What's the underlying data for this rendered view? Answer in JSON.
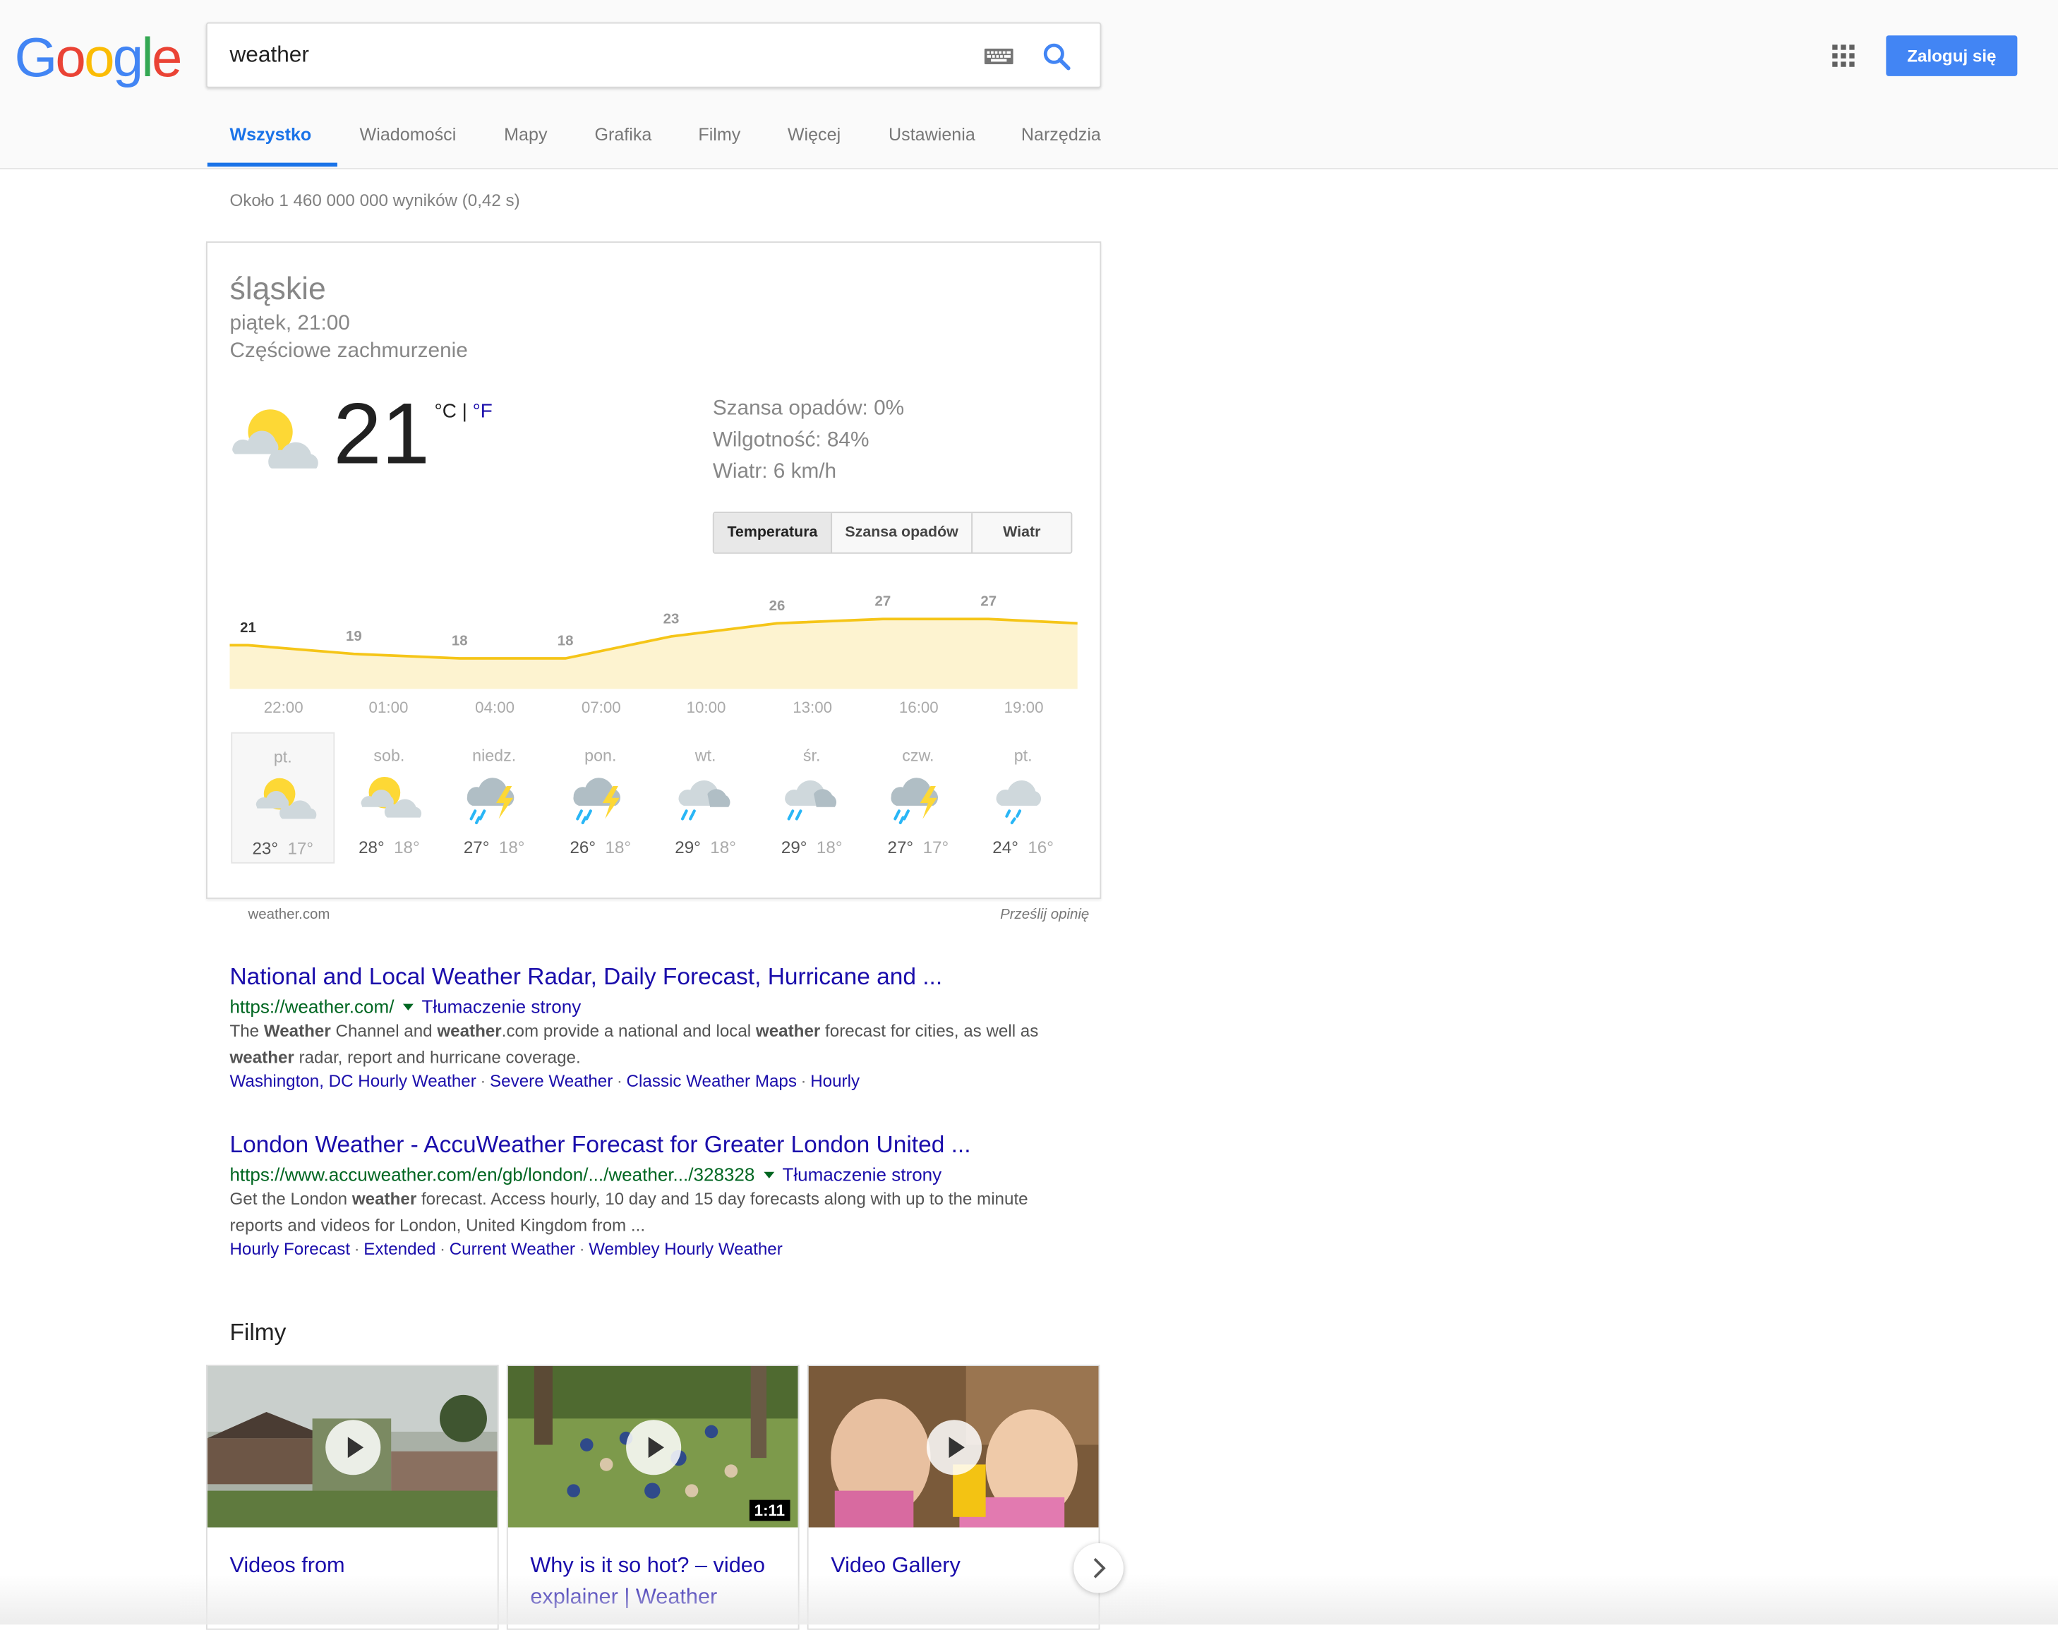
{
  "header": {
    "logo": "Google",
    "search_query": "weather",
    "login_label": "Zaloguj się",
    "tabs": [
      "Wszystko",
      "Wiadomości",
      "Mapy",
      "Grafika",
      "Filmy",
      "Więcej",
      "Ustawienia",
      "Narzędzia"
    ]
  },
  "stats": "Około 1 460 000 000 wyników (0,42 s)",
  "weather": {
    "location": "śląskie",
    "time": "piątek, 21:00",
    "condition": "Częściowe zachmurzenie",
    "temp": "21",
    "unit_c": "°C",
    "unit_sep": " | ",
    "unit_f": "°F",
    "precip": "Szansa opadów: 0%",
    "humidity": "Wilgotność: 84%",
    "wind": "Wiatr: 6 km/h",
    "switch": [
      "Temperatura",
      "Szansa opadów",
      "Wiatr"
    ],
    "hours": [
      "22:00",
      "01:00",
      "04:00",
      "07:00",
      "10:00",
      "13:00",
      "16:00",
      "19:00"
    ],
    "hourly_temps": [
      "21",
      "19",
      "18",
      "18",
      "23",
      "26",
      "27",
      "27"
    ],
    "days": [
      {
        "name": "pt.",
        "icon": "partly-cloudy-icon",
        "hi": "23°",
        "lo": "17°"
      },
      {
        "name": "sob.",
        "icon": "partly-cloudy-icon",
        "hi": "28°",
        "lo": "18°"
      },
      {
        "name": "niedz.",
        "icon": "thunderstorm-icon",
        "hi": "27°",
        "lo": "18°"
      },
      {
        "name": "pon.",
        "icon": "thunderstorm-icon",
        "hi": "26°",
        "lo": "18°"
      },
      {
        "name": "wt.",
        "icon": "rain-cloud-icon",
        "hi": "29°",
        "lo": "18°"
      },
      {
        "name": "śr.",
        "icon": "rain-cloud-icon",
        "hi": "29°",
        "lo": "18°"
      },
      {
        "name": "czw.",
        "icon": "thunderstorm-icon",
        "hi": "27°",
        "lo": "17°"
      },
      {
        "name": "pt.",
        "icon": "showers-icon",
        "hi": "24°",
        "lo": "16°"
      }
    ],
    "source": "weather.com",
    "feedback": "Prześlij opinię",
    "colors": {
      "line": "#f5c518",
      "fill": "#fdf3d0"
    }
  },
  "results": [
    {
      "title": "National and Local Weather Radar, Daily Forecast, Hurricane and ...",
      "url": "https://weather.com/",
      "translate": "Tłumaczenie strony",
      "snippet_parts": [
        "The ",
        "Weather",
        " Channel and ",
        "weather",
        ".com provide a national and local ",
        "weather",
        " forecast for cities, as well as ",
        "weather",
        " radar, report and hurricane coverage."
      ],
      "links": [
        "Washington, DC Hourly Weather",
        "Severe Weather",
        "Classic Weather Maps",
        "Hourly"
      ]
    },
    {
      "title": "London Weather - AccuWeather Forecast for Greater London United ...",
      "url": "https://www.accuweather.com/en/gb/london/.../weather.../328328",
      "translate": "Tłumaczenie strony",
      "snippet_parts": [
        "Get the London ",
        "weather",
        " forecast. Access hourly, 10 day and 15 day forecasts along with up to the minute reports and videos for London, United Kingdom from  ..."
      ],
      "links": [
        "Hourly Forecast",
        "Extended",
        "Current Weather",
        "Wembley Hourly Weather"
      ]
    }
  ],
  "videos": {
    "heading": "Filmy",
    "items": [
      {
        "title": "Videos from",
        "duration": ""
      },
      {
        "title": "Why is it so hot? – video explainer | Weather",
        "duration": "1:11"
      },
      {
        "title": "Video Gallery",
        "duration": ""
      }
    ]
  }
}
